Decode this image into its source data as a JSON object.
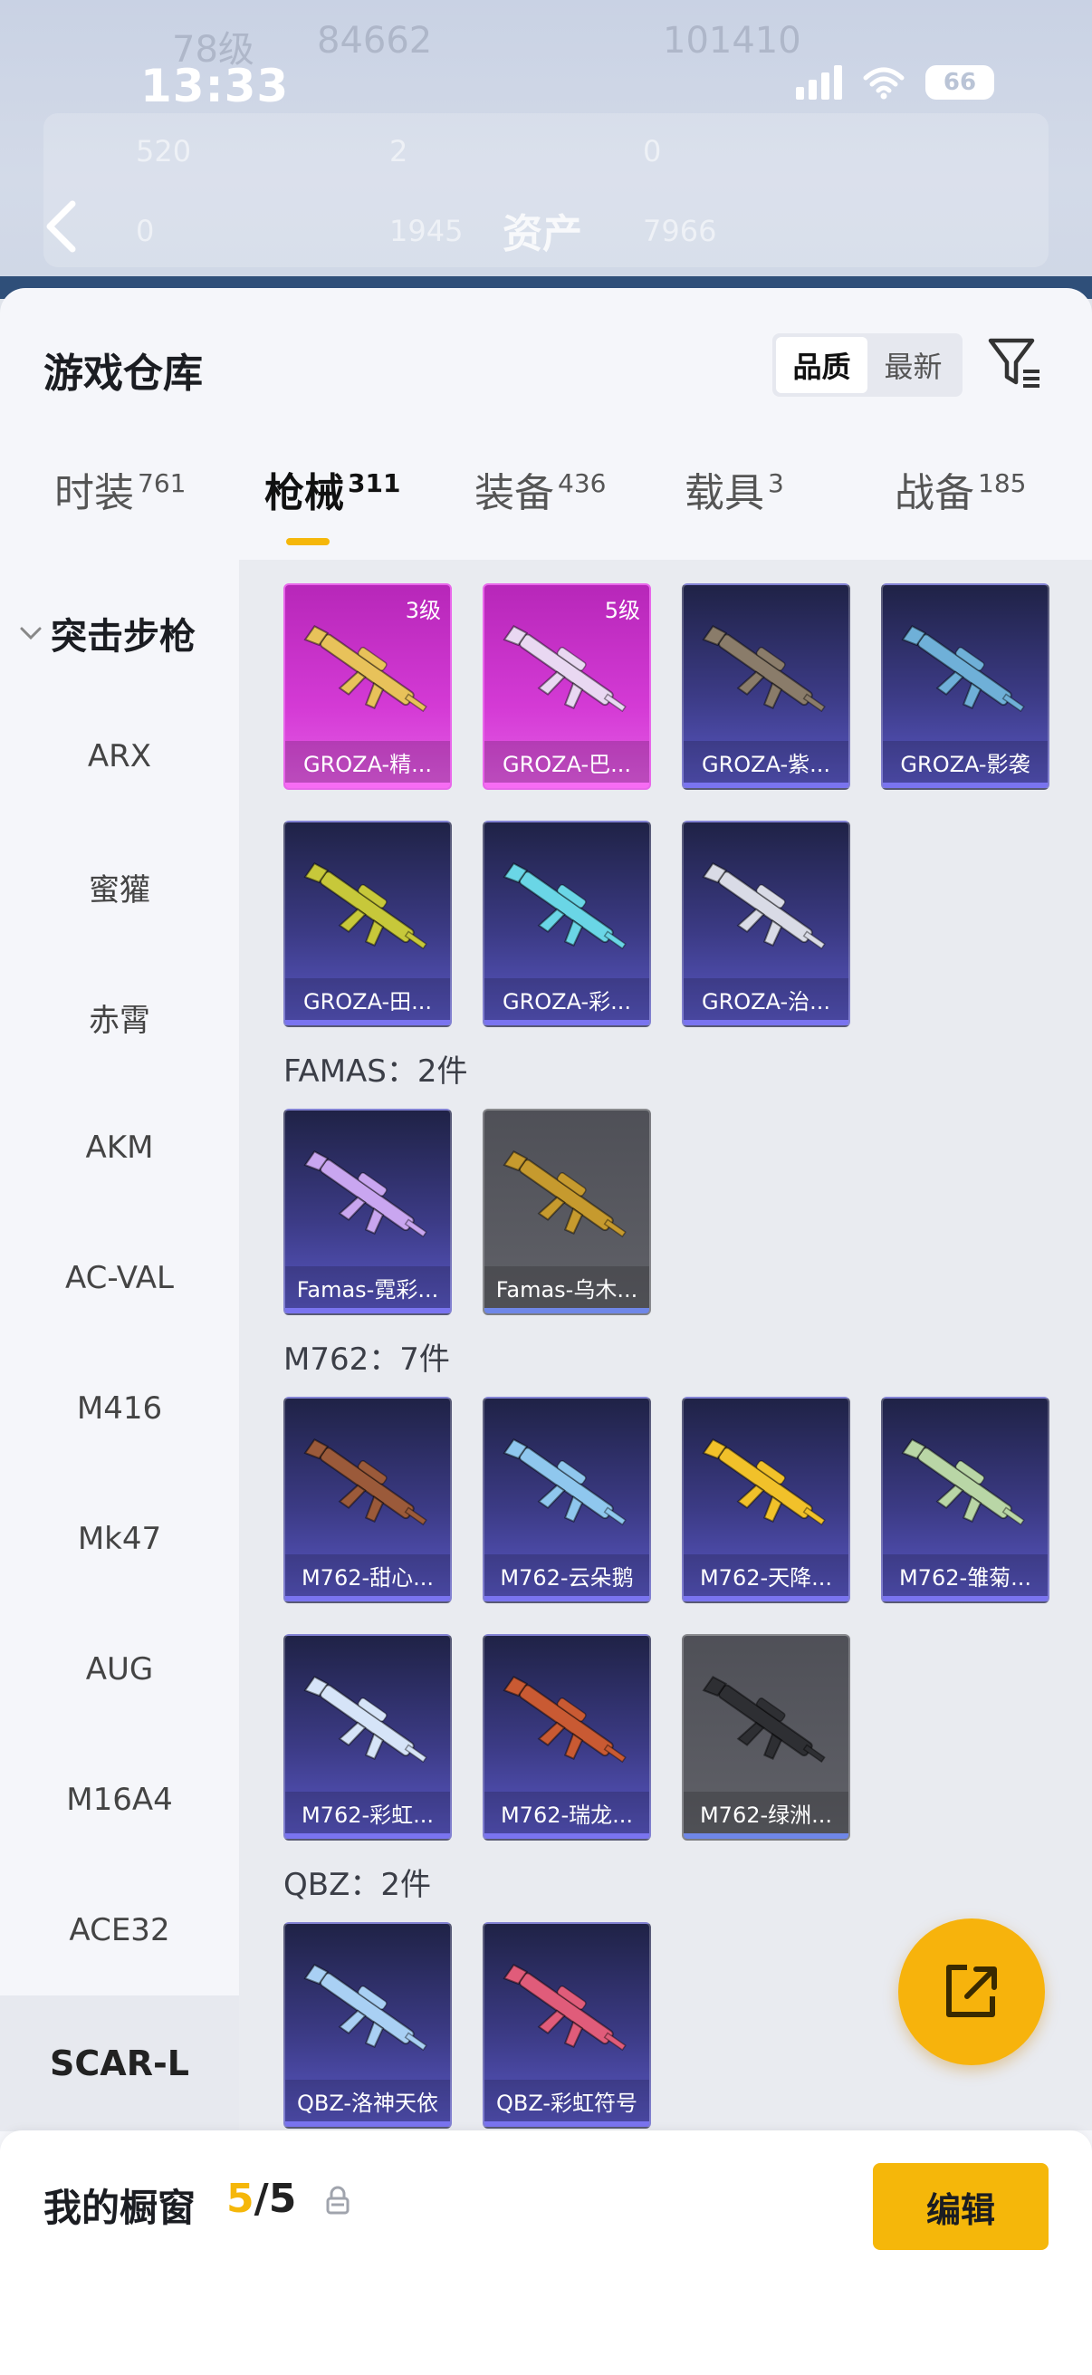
{
  "status_bar": {
    "time": "13:33",
    "battery": "66"
  },
  "background_header": {
    "level": "78级",
    "coins": "84662",
    "points": "101410",
    "stats_row1": [
      "520",
      "2",
      "0"
    ],
    "stats_row2": [
      "0",
      "1945",
      "7966"
    ],
    "title": "资产"
  },
  "sheet": {
    "title": "游戏仓库",
    "sort": {
      "options": [
        "品质",
        "最新"
      ],
      "selected": "品质"
    }
  },
  "tabs": [
    {
      "label": "时装",
      "count": "761"
    },
    {
      "label": "枪械",
      "count": "311",
      "active": true
    },
    {
      "label": "装备",
      "count": "436"
    },
    {
      "label": "载具",
      "count": "3"
    },
    {
      "label": "战备",
      "count": "185"
    }
  ],
  "sidebar": {
    "group": "突击步枪",
    "items": [
      "ARX",
      "蜜獾",
      "赤霄",
      "AKM",
      "AC-VAL",
      "M416",
      "Mk47",
      "AUG",
      "M16A4",
      "ACE32"
    ],
    "selected": "SCAR-L"
  },
  "sections": {
    "famas": "FAMAS：2件",
    "m762": "M762：7件",
    "qbz": "QBZ：2件"
  },
  "cards": {
    "groza": [
      {
        "name": "GROZA-精...",
        "level": "3级",
        "rarity": "pink"
      },
      {
        "name": "GROZA-巴...",
        "level": "5级",
        "rarity": "pink"
      },
      {
        "name": "GROZA-紫...",
        "rarity": "blue"
      },
      {
        "name": "GROZA-影袭",
        "rarity": "blue"
      },
      {
        "name": "GROZA-田...",
        "rarity": "blue"
      },
      {
        "name": "GROZA-彩...",
        "rarity": "blue"
      },
      {
        "name": "GROZA-治...",
        "rarity": "blue"
      }
    ],
    "famas": [
      {
        "name": "Famas-霓彩...",
        "rarity": "blue"
      },
      {
        "name": "Famas-乌木...",
        "rarity": "gray"
      }
    ],
    "m762": [
      {
        "name": "M762-甜心...",
        "rarity": "blue"
      },
      {
        "name": "M762-云朵鹅",
        "rarity": "blue"
      },
      {
        "name": "M762-天降...",
        "rarity": "blue"
      },
      {
        "name": "M762-雏菊...",
        "rarity": "blue"
      },
      {
        "name": "M762-彩虹...",
        "rarity": "blue"
      },
      {
        "name": "M762-瑞龙...",
        "rarity": "blue"
      },
      {
        "name": "M762-绿洲...",
        "rarity": "gray"
      }
    ],
    "qbz": [
      {
        "name": "QBZ-洛神天依",
        "rarity": "blue"
      },
      {
        "name": "QBZ-彩虹符号",
        "rarity": "blue"
      }
    ]
  },
  "bottom_bar": {
    "title": "我的橱窗",
    "current": "5",
    "total": "/5",
    "edit_label": "编辑"
  },
  "colors": {
    "accent": "#f5b70a",
    "rarity_pink": "#d43ad5",
    "rarity_blue": "#3c3b86",
    "rarity_gray": "#5b5c63"
  }
}
